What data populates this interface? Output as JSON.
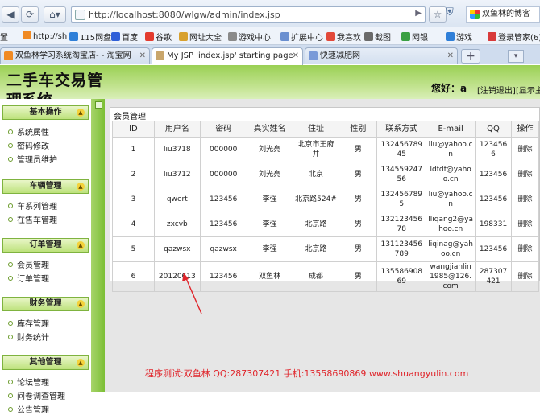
{
  "browser": {
    "url": "http://localhost:8080/wlgw/admin/index.jsp",
    "profile_label": "双鱼林的博客",
    "bookmarks": [
      {
        "label": "置",
        "color": "#ffffff"
      },
      {
        "label": "http://sh",
        "color": "#f08a24"
      },
      {
        "label": "115网盘",
        "color": "#2f7fd8"
      },
      {
        "label": "百度",
        "color": "#2f5fd8"
      },
      {
        "label": "谷歌",
        "color": "#e33b2e"
      },
      {
        "label": "网址大全",
        "color": "#d8a12f"
      },
      {
        "label": "游戏中心",
        "color": "#8a8a8a"
      },
      {
        "label": "扩展中心",
        "color": "#6a8fd0"
      },
      {
        "label": "我喜欢",
        "color": "#e2493a"
      },
      {
        "label": "截图",
        "color": "#6a6a6a"
      },
      {
        "label": "网银",
        "color": "#3aa043"
      },
      {
        "label": "游戏",
        "color": "#2f7fd8"
      },
      {
        "label": "登录管家(6)",
        "color": "#d83a3a"
      }
    ],
    "tabs": [
      {
        "label": "双鱼林学习系统淘宝店- - 淘宝网",
        "active": false,
        "color": "#f08a24"
      },
      {
        "label": "My JSP 'index.jsp' starting page",
        "active": true,
        "color": "#c9a66b"
      },
      {
        "label": "快速减肥网",
        "active": false,
        "color": "#7a9ad8"
      }
    ]
  },
  "header": {
    "title_line1": "二手车交易管",
    "title_line2": "理系统",
    "greeting": "您好：a",
    "logout": "[注销退出]",
    "show_main": "[显示主"
  },
  "sidebar": {
    "groups": [
      {
        "title": "基本操作",
        "items": [
          "系统属性",
          "密码修改",
          "管理员维护"
        ]
      },
      {
        "title": "车辆管理",
        "items": [
          "车系列管理",
          "在售车管理"
        ]
      },
      {
        "title": "订单管理",
        "items": [
          "会员管理",
          "订单管理"
        ]
      },
      {
        "title": "财务管理",
        "items": [
          "库存管理",
          "财务统计"
        ]
      },
      {
        "title": "其他管理",
        "items": [
          "论坛管理",
          "问卷调查管理",
          "公告管理"
        ]
      }
    ]
  },
  "main": {
    "panel_title": "会员管理",
    "columns": [
      "ID",
      "用户名",
      "密码",
      "真实姓名",
      "住址",
      "性别",
      "联系方式",
      "E-mail",
      "QQ",
      "操作"
    ],
    "rows": [
      [
        "1",
        "liu3718",
        "000000",
        "刘光亮",
        "北京市王府井",
        "男",
        "13245678945",
        "liu@yahoo.cn",
        "1234566",
        "删除"
      ],
      [
        "2",
        "liu3712",
        "000000",
        "刘光亮",
        "北京",
        "男",
        "13455924756",
        "ldfdf@yahoo.cn",
        "123456",
        "删除"
      ],
      [
        "3",
        "qwert",
        "123456",
        "李强",
        "北京路524#",
        "男",
        "1324567895",
        "liu@yahoo.cn",
        "123456",
        "删除"
      ],
      [
        "4",
        "zxcvb",
        "123456",
        "李强",
        "北京路",
        "男",
        "13212345678",
        "lliqang2@yahoo.cn",
        "198331",
        "删除"
      ],
      [
        "5",
        "qazwsx",
        "qazwsx",
        "李强",
        "北京路",
        "男",
        "131123456789",
        "liqinag@yahoo.cn",
        "123456",
        "删除"
      ],
      [
        "6",
        "20120613",
        "123456",
        "双鱼林",
        "成都",
        "男",
        "13558690869",
        "wangjianlin1985@126.com",
        "287307421",
        "删除"
      ]
    ]
  },
  "footer": {
    "credit": "程序测试:双鱼林 QQ:287307421 手机:13558690869 www.shuangyulin.com"
  }
}
